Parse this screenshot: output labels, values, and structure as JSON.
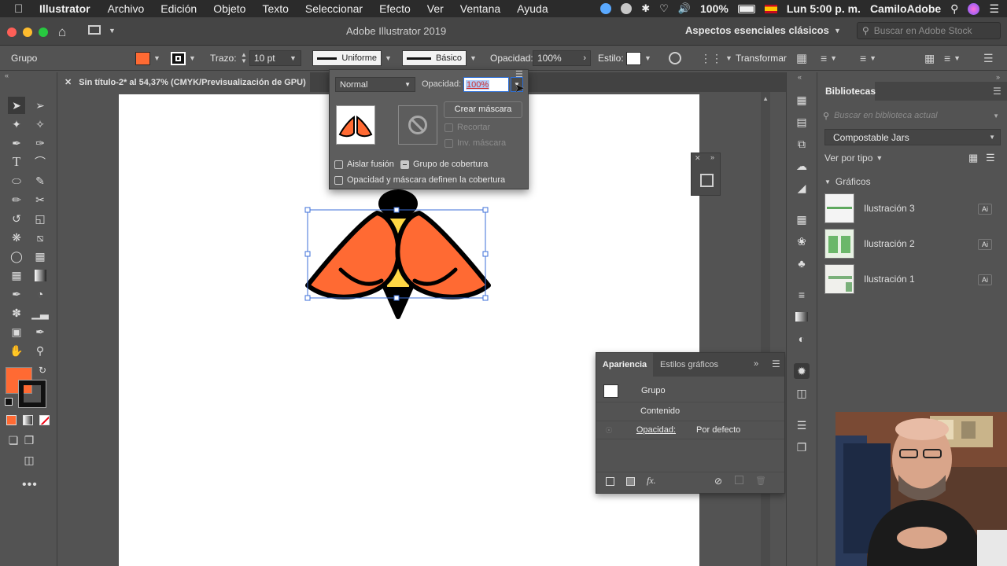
{
  "menubar": {
    "app_name": "Illustrator",
    "items": [
      "Archivo",
      "Edición",
      "Objeto",
      "Texto",
      "Seleccionar",
      "Efecto",
      "Ver",
      "Ventana",
      "Ayuda"
    ],
    "battery": "100%",
    "clock": "Lun 5:00 p. m.",
    "user": "CamiloAdobe"
  },
  "titlebar": {
    "title": "Adobe Illustrator 2019",
    "workspace": "Aspectos esenciales clásicos",
    "search_placeholder": "Buscar en Adobe Stock"
  },
  "controlbar": {
    "selection_label": "Grupo",
    "stroke_label": "Trazo:",
    "stroke_value": "10 pt",
    "profile_label": "Uniforme",
    "brush_label": "Básico",
    "opacity_label": "Opacidad:",
    "opacity_value": "100%",
    "style_label": "Estilo:",
    "transform_label": "Transformar",
    "fill_color": "#ff6a33"
  },
  "tab": {
    "title": "Sin título-2* al 54,37% (CMYK/Previsualización de GPU)"
  },
  "opacity_popup": {
    "blend_mode": "Normal",
    "opacity_label": "Opacidad:",
    "opacity_value": "100%",
    "make_mask_button": "Crear máscara",
    "clip_label": "Recortar",
    "invert_mask_label": "Inv. máscara",
    "isolate_blending_label": "Aislar fusión",
    "knockout_group_label": "Grupo de cobertura",
    "opacity_mask_knockout_label": "Opacidad y máscara definen la cobertura"
  },
  "appearance": {
    "tab_active": "Apariencia",
    "tab_inactive": "Estilos gráficos",
    "row_group": "Grupo",
    "row_contents": "Contenido",
    "row_opacity_label": "Opacidad:",
    "row_opacity_value": "Por defecto"
  },
  "libraries": {
    "title": "Bibliotecas",
    "search_placeholder": "Buscar en biblioteca actual",
    "library_name": "Compostable Jars",
    "view_by": "Ver por tipo",
    "section": "Gráficos",
    "items": [
      {
        "name": "Ilustración 3",
        "badge": "Ai"
      },
      {
        "name": "Ilustración 2",
        "badge": "Ai"
      },
      {
        "name": "Ilustración 1",
        "badge": "Ai"
      }
    ]
  },
  "colors": {
    "accent_orange": "#ff6a33",
    "selection_blue": "#3c6fd8"
  }
}
